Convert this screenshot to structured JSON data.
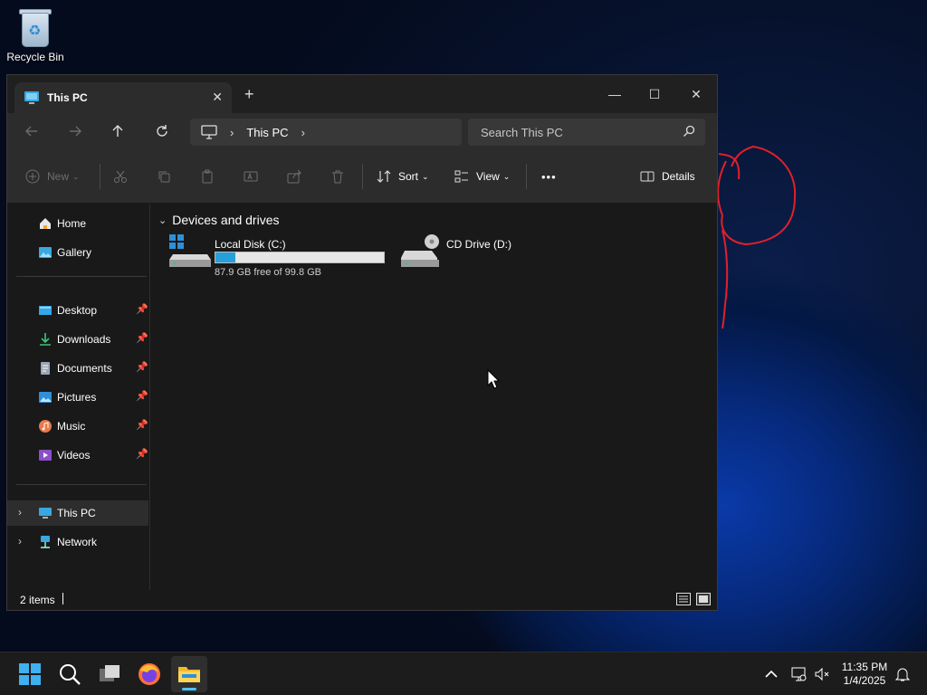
{
  "desktop": {
    "recycle_bin_label": "Recycle Bin"
  },
  "window": {
    "tab_title": "This PC",
    "new_tab_symbol": "+",
    "close_tab_symbol": "✕",
    "minimize_symbol": "—",
    "maximize_symbol": "☐",
    "close_symbol": "✕",
    "address": {
      "crumb": "This PC"
    },
    "search": {
      "placeholder": "Search This PC"
    },
    "commands": {
      "new_label": "New",
      "sort_label": "Sort",
      "view_label": "View",
      "more_label": "•••",
      "details_label": "Details"
    }
  },
  "sidebar": {
    "quick": [
      {
        "label": "Home",
        "icon": "home-icon"
      },
      {
        "label": "Gallery",
        "icon": "gallery-icon"
      }
    ],
    "pinned": [
      {
        "label": "Desktop",
        "icon": "desktop-folder-icon"
      },
      {
        "label": "Downloads",
        "icon": "downloads-icon"
      },
      {
        "label": "Documents",
        "icon": "documents-icon"
      },
      {
        "label": "Pictures",
        "icon": "pictures-icon"
      },
      {
        "label": "Music",
        "icon": "music-icon"
      },
      {
        "label": "Videos",
        "icon": "videos-icon"
      }
    ],
    "locations": [
      {
        "label": "This PC",
        "icon": "this-pc-icon",
        "selected": true
      },
      {
        "label": "Network",
        "icon": "network-icon",
        "selected": false
      }
    ]
  },
  "content": {
    "group_title": "Devices and drives",
    "drives": [
      {
        "name": "Local Disk (C:)",
        "free_text": "87.9 GB free of 99.8 GB",
        "used_fraction": 0.119
      },
      {
        "name": "CD Drive (D:)"
      }
    ]
  },
  "status": {
    "item_count": "2 items"
  },
  "taskbar": {
    "time": "11:35 PM",
    "date": "1/4/2025",
    "apps": [
      "start-icon",
      "search-icon",
      "task-view-icon",
      "firefox-icon",
      "file-explorer-icon"
    ]
  },
  "colors": {
    "accent": "#4cc2ff",
    "drive_bar_fill": "#26a0da",
    "window_bg": "#191919",
    "chrome_bg": "#2c2c2c",
    "annotation_red": "#e0202a"
  }
}
